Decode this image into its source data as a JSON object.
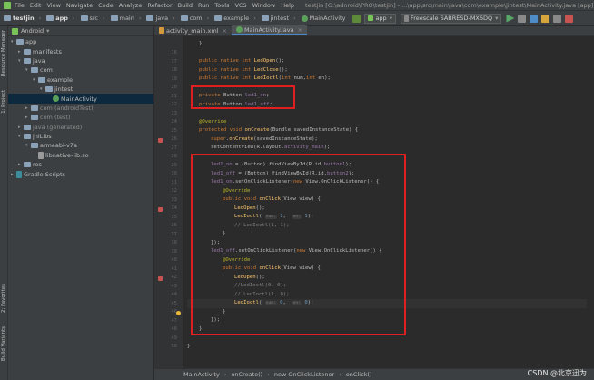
{
  "menu": {
    "items": [
      "File",
      "Edit",
      "View",
      "Navigate",
      "Code",
      "Analyze",
      "Refactor",
      "Build",
      "Run",
      "Tools",
      "VCS",
      "Window",
      "Help"
    ],
    "title": "testjin [G:\\adnroid\\PRO\\testjin] - ...\\app\\src\\main\\java\\com\\example\\jintest\\MainActivity.java [app]"
  },
  "breadcrumb": [
    "testjin",
    "app",
    "src",
    "main",
    "java",
    "com",
    "example",
    "jintest",
    "MainActivity"
  ],
  "toolbar": {
    "run_config": "app",
    "device": "Freescale SABRESD-MX6DQ"
  },
  "left_strip": {
    "top": "1: Project",
    "resource": "Resource Manager",
    "favorites": "2: Favorites",
    "build_variants": "Build Variants"
  },
  "project": {
    "view": "Android",
    "tree": [
      {
        "label": "app",
        "depth": 0,
        "type": "folder",
        "open": true
      },
      {
        "label": "manifests",
        "depth": 1,
        "type": "folder",
        "open": false
      },
      {
        "label": "java",
        "depth": 1,
        "type": "folder",
        "open": true
      },
      {
        "label": "com",
        "depth": 2,
        "type": "folder",
        "open": true
      },
      {
        "label": "example",
        "depth": 3,
        "type": "folder",
        "open": true
      },
      {
        "label": "jintest",
        "depth": 4,
        "type": "folder",
        "open": true
      },
      {
        "label": "MainActivity",
        "depth": 5,
        "type": "class",
        "open": false,
        "selected": true
      },
      {
        "label": "com (androidTest)",
        "depth": 2,
        "type": "folder",
        "open": false
      },
      {
        "label": "com (test)",
        "depth": 2,
        "type": "folder",
        "open": false
      },
      {
        "label": "java (generated)",
        "depth": 1,
        "type": "folder",
        "open": false
      },
      {
        "label": "jniLibs",
        "depth": 1,
        "type": "folder",
        "open": true
      },
      {
        "label": "armeabi-v7a",
        "depth": 2,
        "type": "folder",
        "open": true
      },
      {
        "label": "libnative-lib.so",
        "depth": 3,
        "type": "file",
        "open": false
      },
      {
        "label": "res",
        "depth": 1,
        "type": "folder",
        "open": false
      },
      {
        "label": "Gradle Scripts",
        "depth": 0,
        "type": "gradle",
        "open": false
      }
    ]
  },
  "tabs": [
    {
      "label": "activity_main.xml",
      "active": false
    },
    {
      "label": "MainActivity.java",
      "active": true
    }
  ],
  "code": {
    "line_numbers": [
      "16",
      "17",
      "18",
      "19",
      "20",
      "21",
      "22",
      "23",
      "24",
      "25",
      "26",
      "27",
      "28",
      "29",
      "30",
      "31",
      "32",
      "33",
      "34",
      "35",
      "36",
      "37",
      "38",
      "39",
      "40",
      "41",
      "42",
      "43",
      "44",
      "45",
      "46",
      "47",
      "48",
      "49",
      "50"
    ],
    "lines": [
      "}",
      "",
      "public native int LedOpen();",
      "public native int LedClose();",
      "public native int LedIoctl(int num,int en);",
      "",
      "private Button led1_on;",
      "private Button led1_off;",
      "",
      "@Override",
      "protected void onCreate(Bundle savedInstanceState) {",
      "super.onCreate(savedInstanceState);",
      "setContentView(R.layout.activity_main);",
      "",
      "led1_on = (Button) findViewById(R.id.button1);",
      "led1_off = (Button) findViewById(R.id.button2);",
      "led1_on.setOnClickListener(new View.OnClickListener() {",
      "@Override",
      "public void onClick(View view) {",
      "LedOpen();",
      "LedIoctl( num: 1,  en: 1);",
      "// LedIoctl(1, 1);",
      "}",
      "});",
      "led1_off.setOnClickListener(new View.OnClickListener() {",
      "@Override",
      "public void onClick(View view) {",
      "LedOpen();",
      "//LedIoctl(0, 0);",
      "// LedIoctl(1, 0);",
      "LedIoctl( num: 0,  en: 0);",
      "}",
      "});",
      "}",
      "",
      "}"
    ]
  },
  "status_breadcrumb": [
    "MainActivity",
    "onCreate()",
    "new OnClickListener",
    "onClick()"
  ],
  "watermark": "CSDN @北京迅为",
  "colors": {
    "red_box": "#e02020",
    "keyword": "#cc7832",
    "method": "#ffc66d",
    "field": "#9876aa"
  }
}
